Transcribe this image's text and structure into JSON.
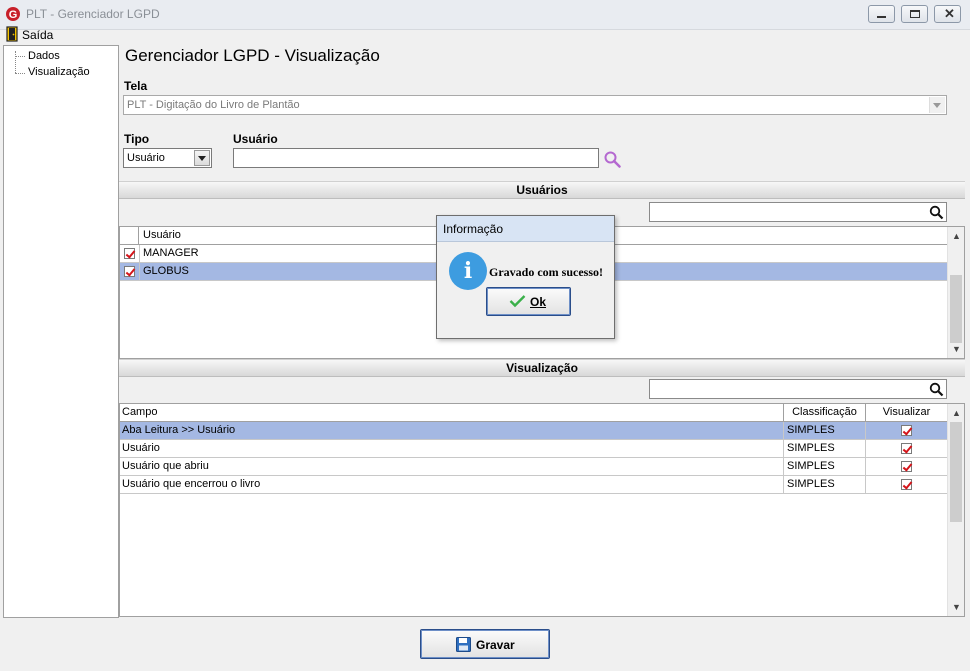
{
  "window": {
    "title": "PLT - Gerenciador LGPD"
  },
  "menu": {
    "exit_label": "Saída"
  },
  "tree": {
    "items": [
      "Dados",
      "Visualização"
    ]
  },
  "page": {
    "title": "Gerenciador LGPD - Visualização"
  },
  "tela": {
    "label": "Tela",
    "value": "PLT - Digitação do Livro de Plantão"
  },
  "filters": {
    "tipo_label": "Tipo",
    "tipo_value": "Usuário",
    "usuario_label": "Usuário",
    "usuario_value": ""
  },
  "usuarios": {
    "section_title": "Usuários",
    "column_header": "Usuário",
    "rows": [
      {
        "name": "MANAGER",
        "checked": true,
        "selected": false
      },
      {
        "name": "GLOBUS",
        "checked": true,
        "selected": true
      }
    ]
  },
  "visualizacao": {
    "section_title": "Visualização",
    "headers": {
      "campo": "Campo",
      "classificacao": "Classificação",
      "visualizar": "Visualizar"
    },
    "rows": [
      {
        "campo": "Aba Leitura >> Usuário",
        "classificacao": "SIMPLES",
        "visualizar": true,
        "selected": true
      },
      {
        "campo": "Usuário",
        "classificacao": "SIMPLES",
        "visualizar": true,
        "selected": false
      },
      {
        "campo": "Usuário que abriu",
        "classificacao": "SIMPLES",
        "visualizar": true,
        "selected": false
      },
      {
        "campo": "Usuário que encerrou o livro",
        "classificacao": "SIMPLES",
        "visualizar": true,
        "selected": false
      }
    ]
  },
  "dialog": {
    "title": "Informação",
    "message": "Gravado com sucesso!",
    "ok_label": "Ok"
  },
  "footer": {
    "save_label": "Gravar"
  },
  "colors": {
    "selection": "#a4b8e3",
    "check": "#d4141a",
    "info_icon": "#3d9ce0"
  }
}
